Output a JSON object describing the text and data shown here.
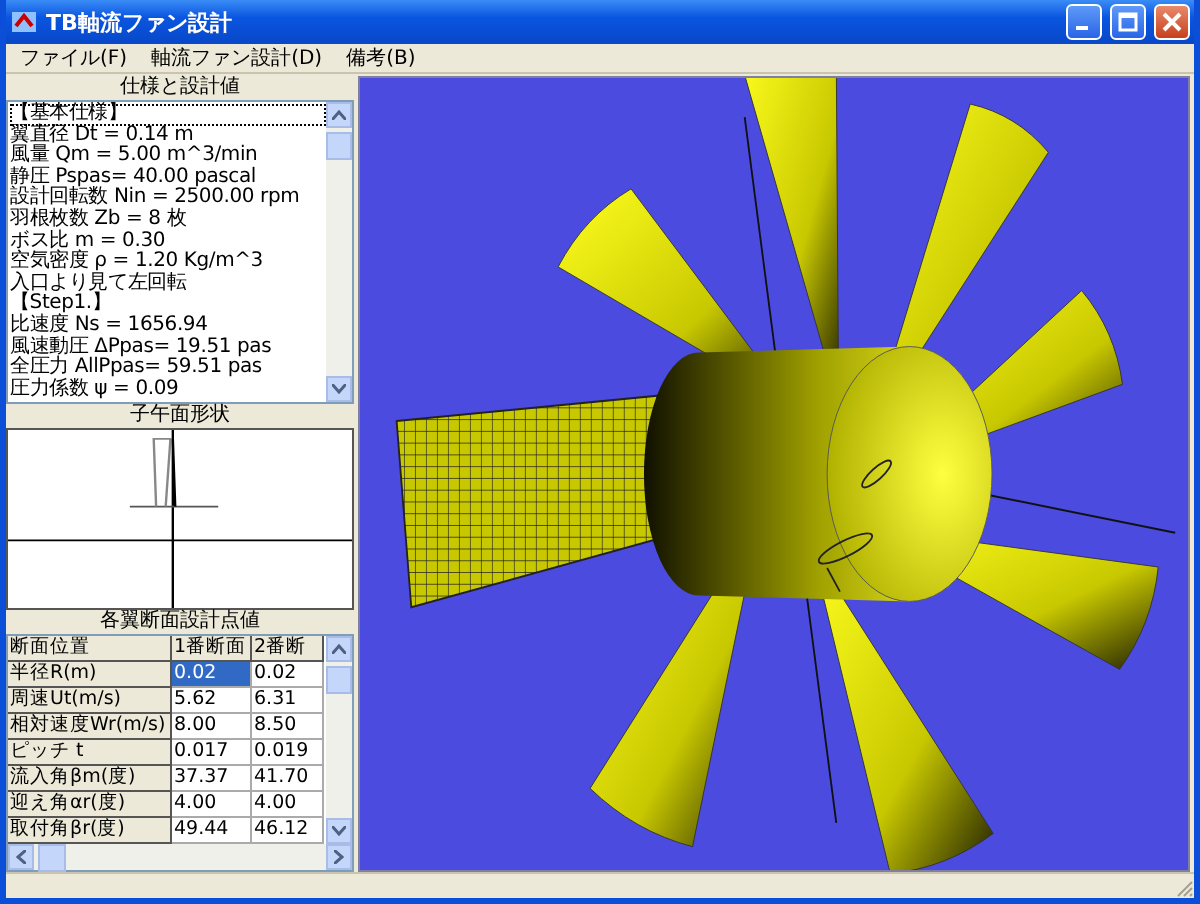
{
  "window": {
    "title": "TB軸流ファン設計"
  },
  "menu": [
    "ファイル(F)",
    "軸流ファン設計(D)",
    "備考(B)"
  ],
  "spec_panel": {
    "title": "仕様と設計値",
    "lines": [
      {
        "text": "【基本仕様】",
        "selected": true
      },
      {
        "text": "翼直径 Dt = 0.14 m",
        "selected": false
      },
      {
        "text": "風量 Qm = 5.00 m^3/min",
        "selected": false
      },
      {
        "text": "静圧 Pspas= 40.00 pascal",
        "selected": false
      },
      {
        "text": "設計回転数 Nin = 2500.00 rpm",
        "selected": false
      },
      {
        "text": "羽根枚数 Zb = 8 枚",
        "selected": false
      },
      {
        "text": "ボス比 m = 0.30",
        "selected": false
      },
      {
        "text": "空気密度 ρ = 1.20 Kg/m^3",
        "selected": false
      },
      {
        "text": "入口より見て左回転",
        "selected": false
      },
      {
        "text": "【Step1.】",
        "selected": false
      },
      {
        "text": "比速度 Ns = 1656.94",
        "selected": false
      },
      {
        "text": "風速動圧 ΔPpas= 19.51 pas",
        "selected": false
      },
      {
        "text": "全圧力 AllPpas= 59.51 pas",
        "selected": false
      },
      {
        "text": "圧力係数 ψ = 0.09",
        "selected": false
      }
    ]
  },
  "meridional_panel": {
    "title": "子午面形状"
  },
  "section_table": {
    "title": "各翼断面設計点値",
    "columns": [
      "断面位置",
      "1番断面",
      "2番断"
    ],
    "rows": [
      {
        "label": "半径R(m)",
        "values": [
          "0.02",
          "0.02"
        ],
        "selected": [
          true,
          false
        ]
      },
      {
        "label": "周速Ut(m/s)",
        "values": [
          "5.62",
          "6.31"
        ],
        "selected": [
          false,
          false
        ]
      },
      {
        "label": "相対速度Wr(m/s)",
        "values": [
          "8.00",
          "8.50"
        ],
        "selected": [
          false,
          false
        ]
      },
      {
        "label": "ピッチ t",
        "values": [
          "0.017",
          "0.019"
        ],
        "selected": [
          false,
          false
        ]
      },
      {
        "label": "流入角βm(度)",
        "values": [
          "37.37",
          "41.70"
        ],
        "selected": [
          false,
          false
        ]
      },
      {
        "label": "迎え角αr(度)",
        "values": [
          "4.00",
          "4.00"
        ],
        "selected": [
          false,
          false
        ]
      },
      {
        "label": "取付角βr(度)",
        "values": [
          "49.44",
          "46.12"
        ],
        "selected": [
          false,
          false
        ]
      }
    ]
  }
}
